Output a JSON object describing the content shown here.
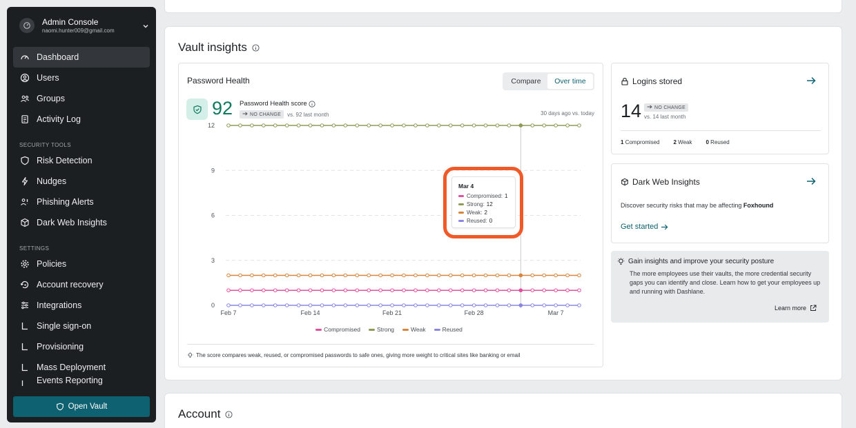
{
  "sidebar": {
    "account": {
      "title": "Admin Console",
      "email": "naomi.hunter009@gmail.com"
    },
    "main_items": [
      {
        "label": "Dashboard",
        "icon": "dashboard-icon",
        "active": true
      },
      {
        "label": "Users",
        "icon": "user-icon"
      },
      {
        "label": "Groups",
        "icon": "groups-icon"
      },
      {
        "label": "Activity Log",
        "icon": "activity-log-icon"
      }
    ],
    "security_heading": "SECURITY TOOLS",
    "security_items": [
      {
        "label": "Risk Detection",
        "icon": "shield-icon"
      },
      {
        "label": "Nudges",
        "icon": "bolt-icon"
      },
      {
        "label": "Phishing Alerts",
        "icon": "phishing-icon"
      },
      {
        "label": "Dark Web Insights",
        "icon": "cube-icon"
      }
    ],
    "settings_heading": "SETTINGS",
    "settings_items": [
      {
        "label": "Policies",
        "icon": "gear-icon"
      },
      {
        "label": "Account recovery",
        "icon": "recovery-icon"
      },
      {
        "label": "Integrations",
        "icon": "sliders-icon"
      },
      {
        "label": "Single sign-on",
        "icon": "corner-icon"
      },
      {
        "label": "Provisioning",
        "icon": "corner-icon"
      },
      {
        "label": "Mass Deployment",
        "icon": "corner-icon"
      },
      {
        "label": "Events Reporting",
        "icon": "corner-icon"
      }
    ],
    "open_vault": "Open Vault"
  },
  "insights": {
    "title": "Vault insights",
    "password_health": {
      "title": "Password Health",
      "toggle": {
        "compare": "Compare",
        "over_time": "Over time"
      },
      "score": "92",
      "score_label": "Password Health score",
      "change_badge": "NO CHANGE",
      "change_text": "vs. 92 last month",
      "range_text": "30 days ago vs. today",
      "footnote": "The score compares weak, reused, or compromised passwords to safe ones, giving more weight to critical sites like banking or email",
      "tooltip": {
        "title": "Mar 4",
        "rows": [
          {
            "label": "Compromised:",
            "value": "1"
          },
          {
            "label": "Strong:",
            "value": "12"
          },
          {
            "label": "Weak:",
            "value": "2"
          },
          {
            "label": "Reused:",
            "value": "0"
          }
        ]
      }
    },
    "logins": {
      "title": "Logins stored",
      "count": "14",
      "badge": "NO CHANGE",
      "sub": "vs. 14 last month",
      "compromised_count": "1",
      "compromised_label": "Compromised",
      "weak_count": "2",
      "weak_label": "Weak",
      "reused_count": "0",
      "reused_label": "Reused"
    },
    "dark_web": {
      "title": "Dark Web Insights",
      "text": "Discover security risks that may be affecting",
      "org": "Foxhound",
      "cta": "Get started"
    },
    "tip": {
      "title": "Gain insights and improve your security posture",
      "body": "The more employees use their vaults, the more credential security gaps you can identify and close. Learn how to get your employees up and running with Dashlane.",
      "link": "Learn more"
    }
  },
  "account_section": {
    "title": "Account"
  },
  "chart_data": {
    "type": "line",
    "x": [
      "Feb 7",
      "Feb 8",
      "Feb 9",
      "Feb 10",
      "Feb 11",
      "Feb 12",
      "Feb 13",
      "Feb 14",
      "Feb 15",
      "Feb 16",
      "Feb 17",
      "Feb 18",
      "Feb 19",
      "Feb 20",
      "Feb 21",
      "Feb 22",
      "Feb 23",
      "Feb 24",
      "Feb 25",
      "Feb 26",
      "Feb 27",
      "Feb 28",
      "Mar 1",
      "Mar 2",
      "Mar 3",
      "Mar 4",
      "Mar 5",
      "Mar 6",
      "Mar 7",
      "Mar 8",
      "Mar 9"
    ],
    "x_tick_labels": [
      "Feb 7",
      "Feb 14",
      "Feb 21",
      "Feb 28",
      "Mar 7"
    ],
    "series": [
      {
        "name": "Compromised",
        "color": "#e0509f",
        "values": [
          1,
          1,
          1,
          1,
          1,
          1,
          1,
          1,
          1,
          1,
          1,
          1,
          1,
          1,
          1,
          1,
          1,
          1,
          1,
          1,
          1,
          1,
          1,
          1,
          1,
          1,
          1,
          1,
          1,
          1,
          1
        ]
      },
      {
        "name": "Strong",
        "color": "#8f9a55",
        "values": [
          12,
          12,
          12,
          12,
          12,
          12,
          12,
          12,
          12,
          12,
          12,
          12,
          12,
          12,
          12,
          12,
          12,
          12,
          12,
          12,
          12,
          12,
          12,
          12,
          12,
          12,
          12,
          12,
          12,
          12,
          12
        ]
      },
      {
        "name": "Weak",
        "color": "#d7853a",
        "values": [
          2,
          2,
          2,
          2,
          2,
          2,
          2,
          2,
          2,
          2,
          2,
          2,
          2,
          2,
          2,
          2,
          2,
          2,
          2,
          2,
          2,
          2,
          2,
          2,
          2,
          2,
          2,
          2,
          2,
          2,
          2
        ]
      },
      {
        "name": "Reused",
        "color": "#8b87e0",
        "values": [
          0,
          0,
          0,
          0,
          0,
          0,
          0,
          0,
          0,
          0,
          0,
          0,
          0,
          0,
          0,
          0,
          0,
          0,
          0,
          0,
          0,
          0,
          0,
          0,
          0,
          0,
          0,
          0,
          0,
          0,
          0
        ]
      }
    ],
    "yticks": [
      0,
      3,
      6,
      9,
      12
    ],
    "ylim": [
      0,
      12
    ],
    "grid": true,
    "legend_position": "bottom",
    "highlighted": "Mar 4"
  }
}
